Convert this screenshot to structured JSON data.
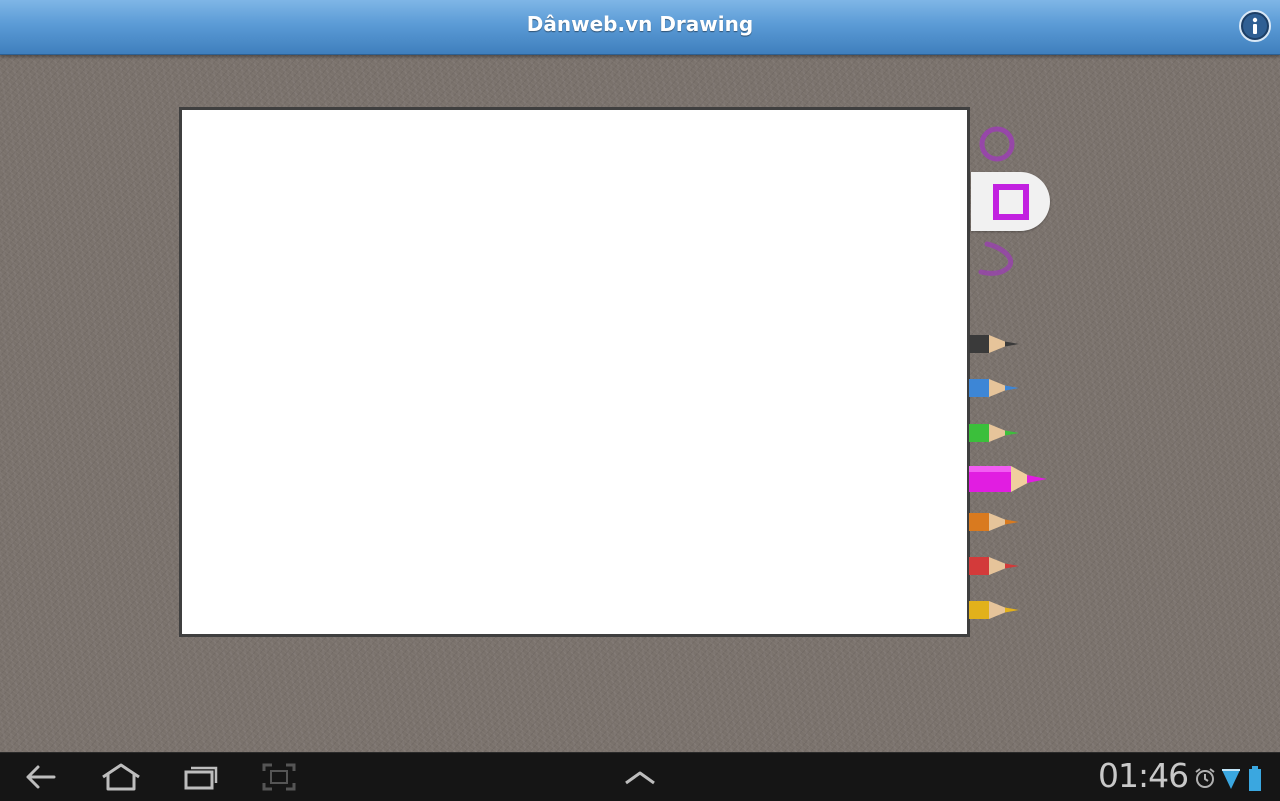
{
  "app": {
    "title": "Dânweb.vn Drawing"
  },
  "tools": {
    "shapes": [
      {
        "name": "circle",
        "selected": false
      },
      {
        "name": "rectangle",
        "selected": true
      },
      {
        "name": "freehand",
        "selected": false
      }
    ],
    "pencil_colors": [
      {
        "name": "black",
        "hex": "#3a3a3a",
        "selected": false
      },
      {
        "name": "blue",
        "hex": "#3d86d6",
        "selected": false
      },
      {
        "name": "green",
        "hex": "#3bbf3b",
        "selected": false
      },
      {
        "name": "magenta",
        "hex": "#e11de1",
        "selected": true
      },
      {
        "name": "orange",
        "hex": "#d97a1f",
        "selected": false
      },
      {
        "name": "red",
        "hex": "#d33a3a",
        "selected": false
      },
      {
        "name": "yellow",
        "hex": "#e2b11b",
        "selected": false
      }
    ],
    "accent": "#b13cc8"
  },
  "status": {
    "time": "01:46"
  },
  "icons": {
    "info": "info-icon",
    "back": "back-icon",
    "home": "home-icon",
    "recent": "recent-apps-icon",
    "screenshot": "screenshot-icon",
    "up": "chevron-up-icon",
    "alarm": "alarm-icon",
    "wifi": "wifi-icon",
    "battery": "battery-icon"
  }
}
